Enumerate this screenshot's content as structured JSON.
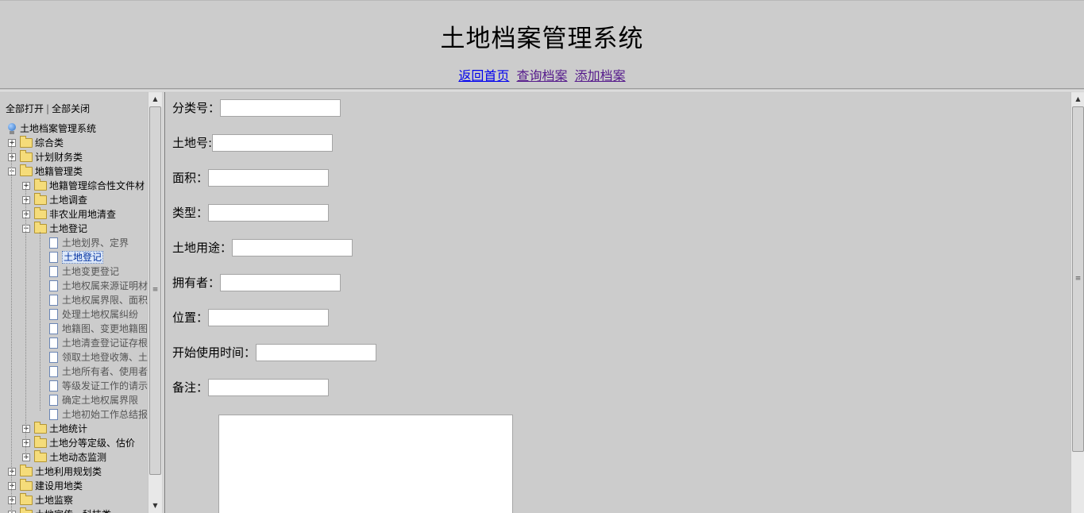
{
  "header": {
    "title": "土地档案管理系统",
    "nav": {
      "home": "返回首页",
      "query": "查询档案",
      "add": "添加档案"
    }
  },
  "tree": {
    "expand_all": "全部打开",
    "separator": "|",
    "collapse_all": "全部关闭",
    "root": "土地档案管理系统",
    "level1_top": [
      {
        "label": "综合类",
        "toggle": "+"
      },
      {
        "label": "计划财务类",
        "toggle": "+"
      },
      {
        "label": "地籍管理类",
        "toggle": "−"
      }
    ],
    "level2_top": [
      {
        "label": "地籍管理综合性文件材",
        "toggle": "+"
      },
      {
        "label": "土地调查",
        "toggle": "+"
      },
      {
        "label": "非农业用地清查",
        "toggle": "+"
      },
      {
        "label": "土地登记",
        "toggle": "−"
      }
    ],
    "leaves": [
      "土地划界、定界",
      "土地登记",
      "土地变更登记",
      "土地权属来源证明材",
      "土地权属界限、面积",
      "处理土地权属纠纷",
      "地籍图、变更地籍图",
      "土地清查登记证存根",
      "领取土地登收簿、土",
      "土地所有者、使用者",
      "等级发证工作的请示",
      "确定土地权属界限",
      "土地初始工作总结报"
    ],
    "selected_leaf_index": 1,
    "level2_bottom": [
      {
        "label": "土地统计",
        "toggle": "+"
      },
      {
        "label": "土地分等定级、估价",
        "toggle": "+"
      },
      {
        "label": "土地动态监测",
        "toggle": "+"
      }
    ],
    "level1_bottom": [
      {
        "label": "土地利用规划类",
        "toggle": "+"
      },
      {
        "label": "建设用地类",
        "toggle": "+"
      },
      {
        "label": "土地监察",
        "toggle": "+"
      },
      {
        "label": "土地宣传、科技类",
        "toggle": "+"
      }
    ]
  },
  "form": {
    "fields": [
      {
        "label": "分类号：",
        "value": ""
      },
      {
        "label": "土地号:",
        "value": ""
      },
      {
        "label": "面积：",
        "value": ""
      },
      {
        "label": "类型：",
        "value": ""
      },
      {
        "label": "土地用途：",
        "value": ""
      },
      {
        "label": "拥有者：",
        "value": ""
      },
      {
        "label": "位置：",
        "value": ""
      },
      {
        "label": "开始使用时间：",
        "value": ""
      },
      {
        "label": "备注：",
        "value": ""
      }
    ],
    "remark_text": ""
  },
  "scrollbars": {
    "up_glyph": "▲",
    "down_glyph": "▼",
    "grip_glyph": "≡"
  }
}
